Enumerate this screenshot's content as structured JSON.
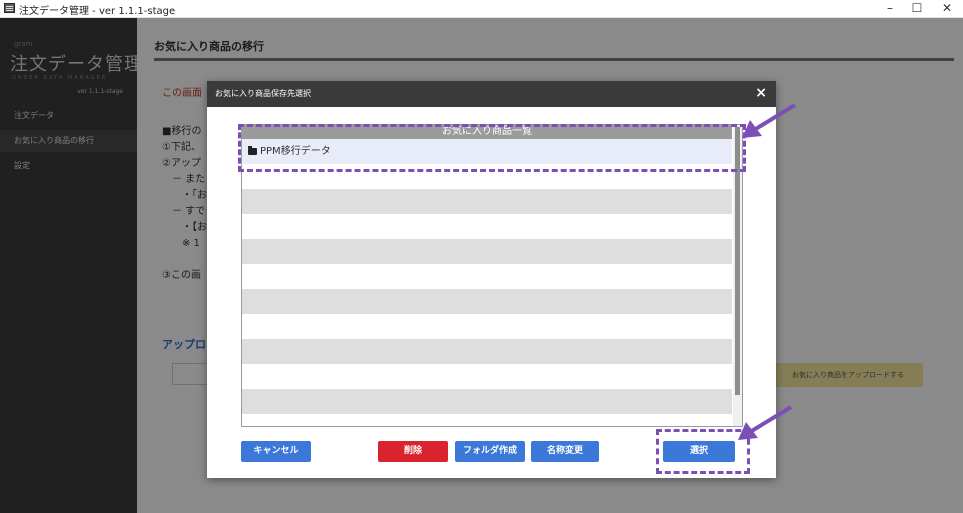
{
  "window": {
    "title": "注文データ管理 - ver 1.1.1-stage",
    "minimize": "–",
    "maximize": "☐",
    "close": "✕"
  },
  "sidebar": {
    "logo_small": "gram",
    "logo": "注文データ管理",
    "logo_sub": "ORDER DATA MANAGER",
    "version": "ver 1.1.1-stage",
    "items": [
      {
        "label": "注文データ"
      },
      {
        "label": "お気に入り商品の移行"
      },
      {
        "label": "設定"
      }
    ]
  },
  "main": {
    "title": "お気に入り商品の移行",
    "note": "この画面",
    "steps": [
      "■移行の",
      "①下記、",
      "②アップ",
      "　－ また",
      "　　・「お",
      "　－ すで",
      "　　・【お",
      "　　※ 1",
      "",
      "③この画"
    ],
    "upload_heading": "アップロ",
    "upload_button": "お気に入り商品をアップロードする"
  },
  "modal": {
    "title": "お気に入り商品保存先選択",
    "close_label": "×",
    "list_header": "お気に入り商品一覧",
    "folders": [
      {
        "name": "PPM移行データ"
      }
    ],
    "buttons": {
      "cancel": "キャンセル",
      "delete": "削除",
      "create_folder": "フォルダ作成",
      "rename": "名称変更",
      "select": "選択"
    }
  },
  "colors": {
    "sidebar_bg": "#3b3b3b",
    "modal_header": "#3a3a3a",
    "primary_button": "#3b78d8",
    "danger_button": "#d9232e",
    "annotation": "#7b4fb5",
    "upload_button": "#f4e7a0"
  }
}
